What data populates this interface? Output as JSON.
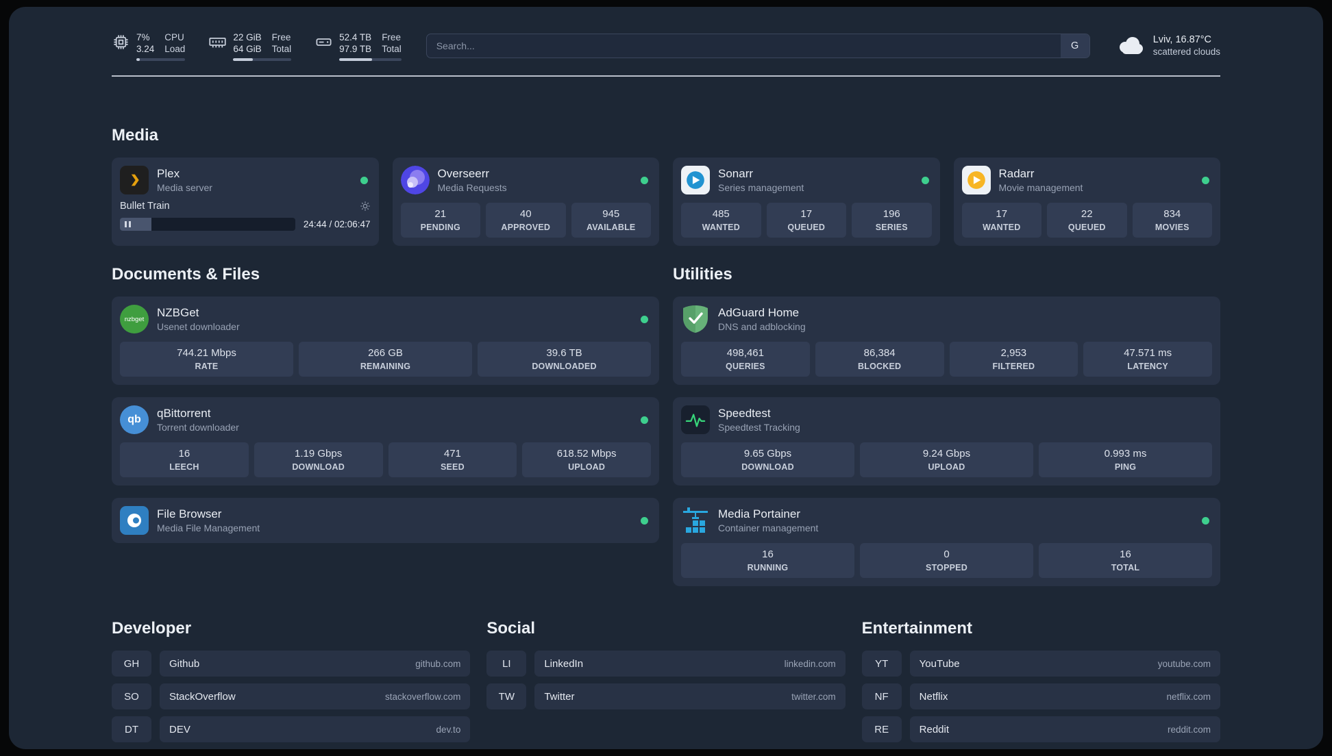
{
  "topbar": {
    "cpu": {
      "value": "7%",
      "sub": "3.24",
      "label_top": "CPU",
      "label_bottom": "Load",
      "progress": 7
    },
    "ram": {
      "value": "22 GiB",
      "sub": "64 GiB",
      "label_top": "Free",
      "label_bottom": "Total",
      "progress": 34
    },
    "disk": {
      "value": "52.4 TB",
      "sub": "97.9 TB",
      "label_top": "Free",
      "label_bottom": "Total",
      "progress": 53
    },
    "search": {
      "placeholder": "Search...",
      "engine_button": "G"
    },
    "weather": {
      "location": "Lviv, 16.87°C",
      "condition": "scattered clouds"
    }
  },
  "media": {
    "title": "Media",
    "plex": {
      "name": "Plex",
      "desc": "Media server",
      "now_playing": "Bullet Train",
      "time": "24:44 / 02:06:47",
      "progress": 18
    },
    "overseerr": {
      "name": "Overseerr",
      "desc": "Media Requests",
      "stats": [
        {
          "value": "21",
          "label": "PENDING"
        },
        {
          "value": "40",
          "label": "APPROVED"
        },
        {
          "value": "945",
          "label": "AVAILABLE"
        }
      ]
    },
    "sonarr": {
      "name": "Sonarr",
      "desc": "Series management",
      "stats": [
        {
          "value": "485",
          "label": "WANTED"
        },
        {
          "value": "17",
          "label": "QUEUED"
        },
        {
          "value": "196",
          "label": "SERIES"
        }
      ]
    },
    "radarr": {
      "name": "Radarr",
      "desc": "Movie management",
      "stats": [
        {
          "value": "17",
          "label": "WANTED"
        },
        {
          "value": "22",
          "label": "QUEUED"
        },
        {
          "value": "834",
          "label": "MOVIES"
        }
      ]
    }
  },
  "documents": {
    "title": "Documents & Files",
    "nzbget": {
      "name": "NZBGet",
      "desc": "Usenet downloader",
      "icon_text": "nzbget",
      "stats": [
        {
          "value": "744.21 Mbps",
          "label": "RATE"
        },
        {
          "value": "266 GB",
          "label": "REMAINING"
        },
        {
          "value": "39.6 TB",
          "label": "DOWNLOADED"
        }
      ]
    },
    "qbittorrent": {
      "name": "qBittorrent",
      "desc": "Torrent downloader",
      "icon_text": "qb",
      "stats": [
        {
          "value": "16",
          "label": "LEECH"
        },
        {
          "value": "1.19 Gbps",
          "label": "DOWNLOAD"
        },
        {
          "value": "471",
          "label": "SEED"
        },
        {
          "value": "618.52 Mbps",
          "label": "UPLOAD"
        }
      ]
    },
    "filebrowser": {
      "name": "File Browser",
      "desc": "Media File Management"
    }
  },
  "utilities": {
    "title": "Utilities",
    "adguard": {
      "name": "AdGuard Home",
      "desc": "DNS and adblocking",
      "stats": [
        {
          "value": "498,461",
          "label": "QUERIES"
        },
        {
          "value": "86,384",
          "label": "BLOCKED"
        },
        {
          "value": "2,953",
          "label": "FILTERED"
        },
        {
          "value": "47.571 ms",
          "label": "LATENCY"
        }
      ]
    },
    "speedtest": {
      "name": "Speedtest",
      "desc": "Speedtest Tracking",
      "stats": [
        {
          "value": "9.65 Gbps",
          "label": "DOWNLOAD"
        },
        {
          "value": "9.24 Gbps",
          "label": "UPLOAD"
        },
        {
          "value": "0.993 ms",
          "label": "PING"
        }
      ]
    },
    "portainer": {
      "name": "Media Portainer",
      "desc": "Container management",
      "stats": [
        {
          "value": "16",
          "label": "RUNNING"
        },
        {
          "value": "0",
          "label": "STOPPED"
        },
        {
          "value": "16",
          "label": "TOTAL"
        }
      ]
    }
  },
  "bookmarks": {
    "developer": {
      "title": "Developer",
      "items": [
        {
          "abbr": "GH",
          "name": "Github",
          "url": "github.com"
        },
        {
          "abbr": "SO",
          "name": "StackOverflow",
          "url": "stackoverflow.com"
        },
        {
          "abbr": "DT",
          "name": "DEV",
          "url": "dev.to"
        }
      ]
    },
    "social": {
      "title": "Social",
      "items": [
        {
          "abbr": "LI",
          "name": "LinkedIn",
          "url": "linkedin.com"
        },
        {
          "abbr": "TW",
          "name": "Twitter",
          "url": "twitter.com"
        }
      ]
    },
    "entertainment": {
      "title": "Entertainment",
      "items": [
        {
          "abbr": "YT",
          "name": "YouTube",
          "url": "youtube.com"
        },
        {
          "abbr": "NF",
          "name": "Netflix",
          "url": "netflix.com"
        },
        {
          "abbr": "RE",
          "name": "Reddit",
          "url": "reddit.com"
        }
      ]
    }
  },
  "status_color": "#3ecf8e"
}
